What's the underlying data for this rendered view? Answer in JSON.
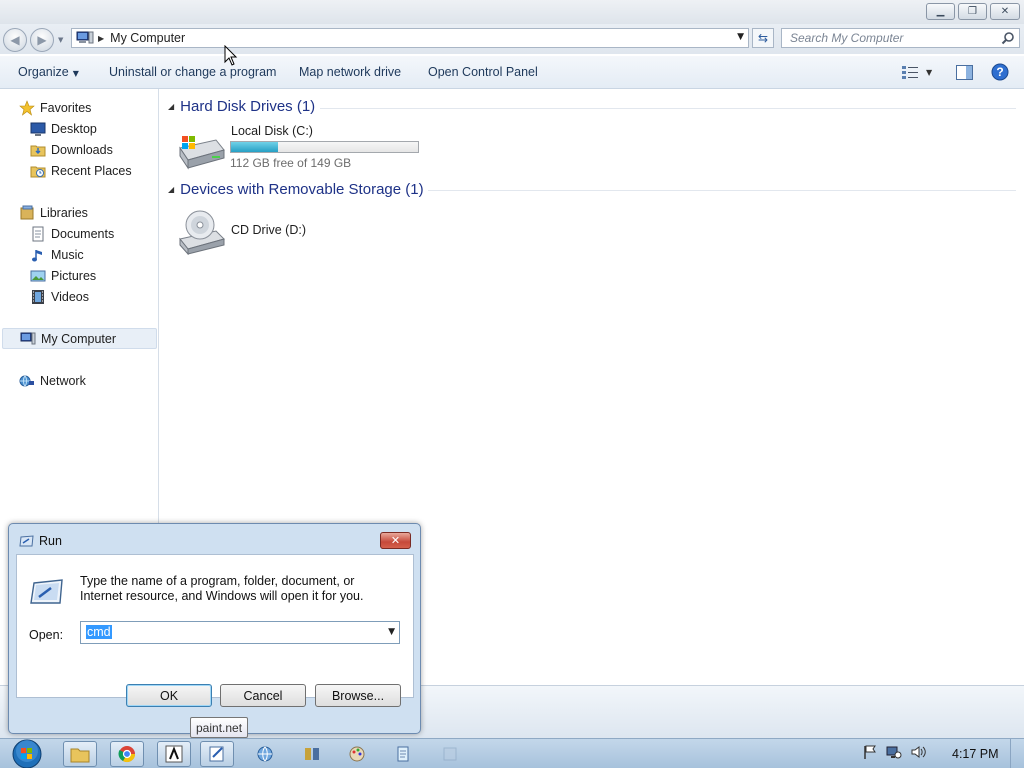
{
  "window": {
    "address": "My Computer",
    "search_placeholder": "Search My Computer",
    "controls": {
      "minimize": "minimize-icon",
      "maximize": "restore-icon",
      "close": "close-icon"
    }
  },
  "toolbar": {
    "organize": "Organize",
    "uninstall": "Uninstall or change a program",
    "map_drive": "Map network drive",
    "control_panel": "Open Control Panel"
  },
  "sidebar": {
    "favorites": "Favorites",
    "desktop": "Desktop",
    "downloads": "Downloads",
    "recent": "Recent Places",
    "libraries": "Libraries",
    "documents": "Documents",
    "music": "Music",
    "pictures": "Pictures",
    "videos": "Videos",
    "computer": "My Computer",
    "network": "Network"
  },
  "content": {
    "hdd_header": "Hard Disk Drives (1)",
    "removable_header": "Devices with Removable Storage (1)",
    "local_disk": {
      "name": "Local Disk (C:)",
      "free_text": "112 GB free of 149 GB",
      "used_fraction": 0.25
    },
    "cd_drive": {
      "name": "CD Drive (D:)"
    }
  },
  "run_dialog": {
    "title": "Run",
    "description": "Type the name of a program, folder, document, or Internet resource, and Windows will open it for you.",
    "open_label": "Open:",
    "value": "cmd",
    "ok": "OK",
    "cancel": "Cancel",
    "browse": "Browse..."
  },
  "tooltip": "paint.net",
  "taskbar": {
    "clock": "4:17 PM"
  },
  "colors": {
    "group_header": "#1e3287",
    "progress_fill": "#26a0c4",
    "close_red": "#c6493a"
  }
}
